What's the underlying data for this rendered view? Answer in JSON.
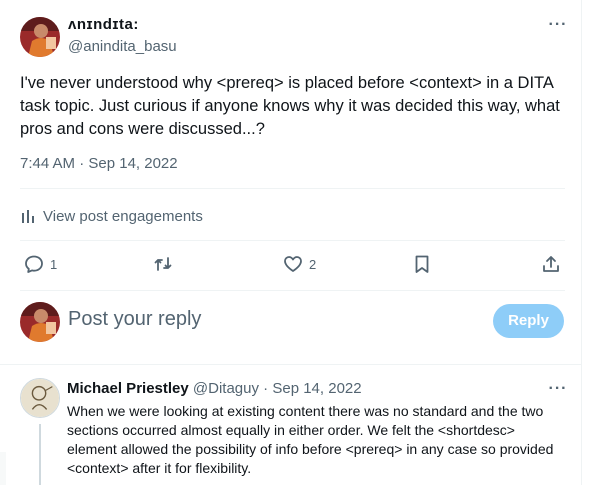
{
  "post": {
    "author_name": "ʌnɪndɪta:",
    "author_handle": "@anindita_basu",
    "text": "I've never understood why <prereq> is placed before <context> in a DITA task topic. Just curious if anyone knows why it was decided this way, what pros and cons were discussed...?",
    "timestamp": "7:44 AM · Sep 14, 2022",
    "engagements_label": "View post engagements",
    "more_icon": "more-icon",
    "stats": {
      "replies": "1",
      "likes": "2"
    }
  },
  "composer": {
    "placeholder": "Post your reply",
    "reply_button": "Reply"
  },
  "reply": {
    "name": "Michael Priestley",
    "handle": "@Ditaguy",
    "date": "Sep 14, 2022",
    "text": "When we were looking at existing content there was no standard and the two sections occurred almost equally in either order. We felt the <shortdesc> element allowed the possibility of info before <prereq> in any case so provided <context> after it for flexibility."
  },
  "colors": {
    "text_primary": "#0f1419",
    "text_secondary": "#536471",
    "divider": "#eff3f4",
    "reply_button_bg": "#8ecdf8"
  }
}
